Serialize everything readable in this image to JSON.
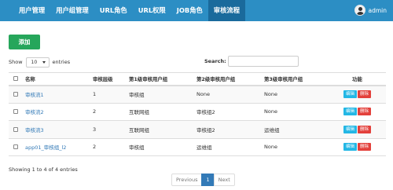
{
  "nav": {
    "items": [
      "用户管理",
      "用户组管理",
      "URL角色",
      "URL权限",
      "JOB角色",
      "审核流程"
    ],
    "active_index": 5,
    "user_name": "admin"
  },
  "toolbar": {
    "add_label": "添加"
  },
  "length_menu": {
    "show_label": "Show",
    "value": "10",
    "entries_label": "entries"
  },
  "search": {
    "label": "Search:",
    "value": ""
  },
  "table": {
    "headers": [
      "",
      "名称",
      "审核层级",
      "第1级审核用户组",
      "第2级审核用户组",
      "第3级审核用户组",
      "功能"
    ],
    "rows": [
      {
        "name": "审核流1",
        "level": "1",
        "g1": "审核组",
        "g2": "None",
        "g3": "None"
      },
      {
        "name": "审核流2",
        "level": "2",
        "g1": "互联网组",
        "g2": "审核组2",
        "g3": "None"
      },
      {
        "name": "审核流3",
        "level": "3",
        "g1": "互联网组",
        "g2": "审核组2",
        "g3": "运维组"
      },
      {
        "name": "app01_审核组_l2",
        "level": "2",
        "g1": "审核组",
        "g2": "运维组",
        "g3": "None"
      }
    ],
    "edit_label": "编辑",
    "delete_label": "删除"
  },
  "footer": {
    "info": "Showing 1 to 4 of 4 entries",
    "pagination": {
      "previous": "Previous",
      "current": "1",
      "next": "Next"
    }
  }
}
